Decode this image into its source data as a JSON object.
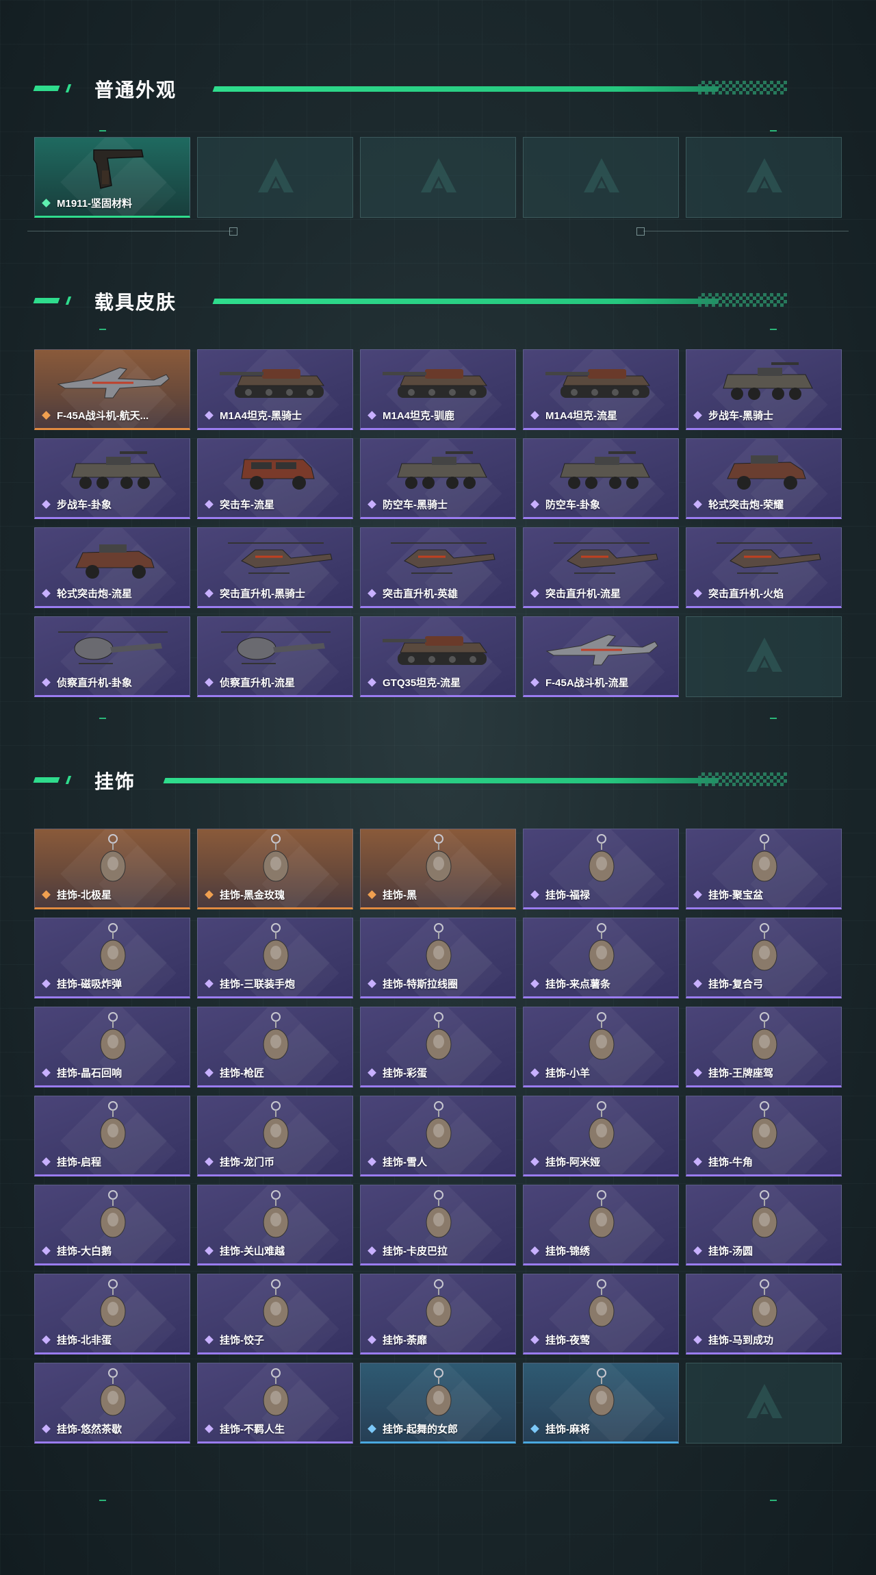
{
  "sections": [
    {
      "title": "普通外观",
      "items": [
        {
          "label": "M1911-坚固材料",
          "rarity": "green",
          "icon": "pistol-icon"
        },
        {
          "label": "",
          "rarity": "empty",
          "icon": "placeholder-emblem-icon"
        },
        {
          "label": "",
          "rarity": "empty",
          "icon": "placeholder-emblem-icon"
        },
        {
          "label": "",
          "rarity": "empty",
          "icon": "placeholder-emblem-icon"
        },
        {
          "label": "",
          "rarity": "empty",
          "icon": "placeholder-emblem-icon"
        }
      ]
    },
    {
      "title": "载具皮肤",
      "items": [
        {
          "label": "F-45A战斗机-航天...",
          "rarity": "orange",
          "icon": "jet-icon"
        },
        {
          "label": "M1A4坦克-黑骑士",
          "rarity": "purple",
          "icon": "tank-icon"
        },
        {
          "label": "M1A4坦克-驯鹿",
          "rarity": "purple",
          "icon": "tank-icon"
        },
        {
          "label": "M1A4坦克-流星",
          "rarity": "purple",
          "icon": "tank-icon"
        },
        {
          "label": "步战车-黑骑士",
          "rarity": "purple",
          "icon": "apc-icon"
        },
        {
          "label": "步战车-卦象",
          "rarity": "purple",
          "icon": "apc-icon"
        },
        {
          "label": "突击车-流星",
          "rarity": "purple",
          "icon": "suv-icon"
        },
        {
          "label": "防空车-黑骑士",
          "rarity": "purple",
          "icon": "apc-icon"
        },
        {
          "label": "防空车-卦象",
          "rarity": "purple",
          "icon": "apc-icon"
        },
        {
          "label": "轮式突击炮-荣耀",
          "rarity": "purple",
          "icon": "armored-car-icon"
        },
        {
          "label": "轮式突击炮-流星",
          "rarity": "purple",
          "icon": "armored-car-icon"
        },
        {
          "label": "突击直升机-黑骑士",
          "rarity": "purple",
          "icon": "helicopter-icon"
        },
        {
          "label": "突击直升机-英雄",
          "rarity": "purple",
          "icon": "helicopter-icon"
        },
        {
          "label": "突击直升机-流星",
          "rarity": "purple",
          "icon": "helicopter-icon"
        },
        {
          "label": "突击直升机-火焰",
          "rarity": "purple",
          "icon": "helicopter-icon"
        },
        {
          "label": "侦察直升机-卦象",
          "rarity": "purple",
          "icon": "scout-helicopter-icon"
        },
        {
          "label": "侦察直升机-流星",
          "rarity": "purple",
          "icon": "scout-helicopter-icon"
        },
        {
          "label": "GTQ35坦克-流星",
          "rarity": "purple",
          "icon": "tank-icon"
        },
        {
          "label": "F-45A战斗机-流星",
          "rarity": "purple",
          "icon": "jet-icon"
        },
        {
          "label": "",
          "rarity": "empty",
          "icon": "placeholder-emblem-icon"
        }
      ]
    },
    {
      "title": "挂饰",
      "items": [
        {
          "label": "挂饰-北极星",
          "rarity": "orange",
          "icon": "charm-icon"
        },
        {
          "label": "挂饰-黑金玫瑰",
          "rarity": "orange",
          "icon": "charm-icon"
        },
        {
          "label": "挂饰-黑",
          "rarity": "orange",
          "icon": "charm-icon"
        },
        {
          "label": "挂饰-福禄",
          "rarity": "purple",
          "icon": "charm-icon"
        },
        {
          "label": "挂饰-聚宝盆",
          "rarity": "purple",
          "icon": "charm-icon"
        },
        {
          "label": "挂饰-磁吸炸弹",
          "rarity": "purple",
          "icon": "charm-icon"
        },
        {
          "label": "挂饰-三联装手炮",
          "rarity": "purple",
          "icon": "charm-icon"
        },
        {
          "label": "挂饰-特斯拉线圈",
          "rarity": "purple",
          "icon": "charm-icon"
        },
        {
          "label": "挂饰-来点薯条",
          "rarity": "purple",
          "icon": "charm-icon"
        },
        {
          "label": "挂饰-复合弓",
          "rarity": "purple",
          "icon": "charm-icon"
        },
        {
          "label": "挂饰-晶石回响",
          "rarity": "purple",
          "icon": "charm-icon"
        },
        {
          "label": "挂饰-枪匠",
          "rarity": "purple",
          "icon": "charm-icon"
        },
        {
          "label": "挂饰-彩蛋",
          "rarity": "purple",
          "icon": "charm-icon"
        },
        {
          "label": "挂饰-小羊",
          "rarity": "purple",
          "icon": "charm-icon"
        },
        {
          "label": "挂饰-王牌座驾",
          "rarity": "purple",
          "icon": "charm-icon"
        },
        {
          "label": "挂饰-启程",
          "rarity": "purple",
          "icon": "charm-icon"
        },
        {
          "label": "挂饰-龙门币",
          "rarity": "purple",
          "icon": "charm-icon"
        },
        {
          "label": "挂饰-雪人",
          "rarity": "purple",
          "icon": "charm-icon"
        },
        {
          "label": "挂饰-阿米娅",
          "rarity": "purple",
          "icon": "charm-icon"
        },
        {
          "label": "挂饰-牛角",
          "rarity": "purple",
          "icon": "charm-icon"
        },
        {
          "label": "挂饰-大白鹅",
          "rarity": "purple",
          "icon": "charm-icon"
        },
        {
          "label": "挂饰-关山难越",
          "rarity": "purple",
          "icon": "charm-icon"
        },
        {
          "label": "挂饰-卡皮巴拉",
          "rarity": "purple",
          "icon": "charm-icon"
        },
        {
          "label": "挂饰-锦绣",
          "rarity": "purple",
          "icon": "charm-icon"
        },
        {
          "label": "挂饰-汤圆",
          "rarity": "purple",
          "icon": "charm-icon"
        },
        {
          "label": "挂饰-北非蛋",
          "rarity": "purple",
          "icon": "charm-icon"
        },
        {
          "label": "挂饰-饺子",
          "rarity": "purple",
          "icon": "charm-icon"
        },
        {
          "label": "挂饰-荼靡",
          "rarity": "purple",
          "icon": "charm-icon"
        },
        {
          "label": "挂饰-夜莺",
          "rarity": "purple",
          "icon": "charm-icon"
        },
        {
          "label": "挂饰-马到成功",
          "rarity": "purple",
          "icon": "charm-icon"
        },
        {
          "label": "挂饰-悠然茶歇",
          "rarity": "purple",
          "icon": "charm-icon"
        },
        {
          "label": "挂饰-不羁人生",
          "rarity": "purple",
          "icon": "charm-icon"
        },
        {
          "label": "挂饰-起舞的女郎",
          "rarity": "blue",
          "icon": "charm-icon"
        },
        {
          "label": "挂饰-麻将",
          "rarity": "blue",
          "icon": "charm-icon"
        },
        {
          "label": "",
          "rarity": "empty",
          "icon": "placeholder-emblem-icon"
        }
      ]
    }
  ],
  "colors": {
    "accent": "#2fdc8d",
    "purple": "#9a7cf0",
    "orange": "#e08a40",
    "blue": "#4aa8e0",
    "background": "#1d2a2e"
  }
}
